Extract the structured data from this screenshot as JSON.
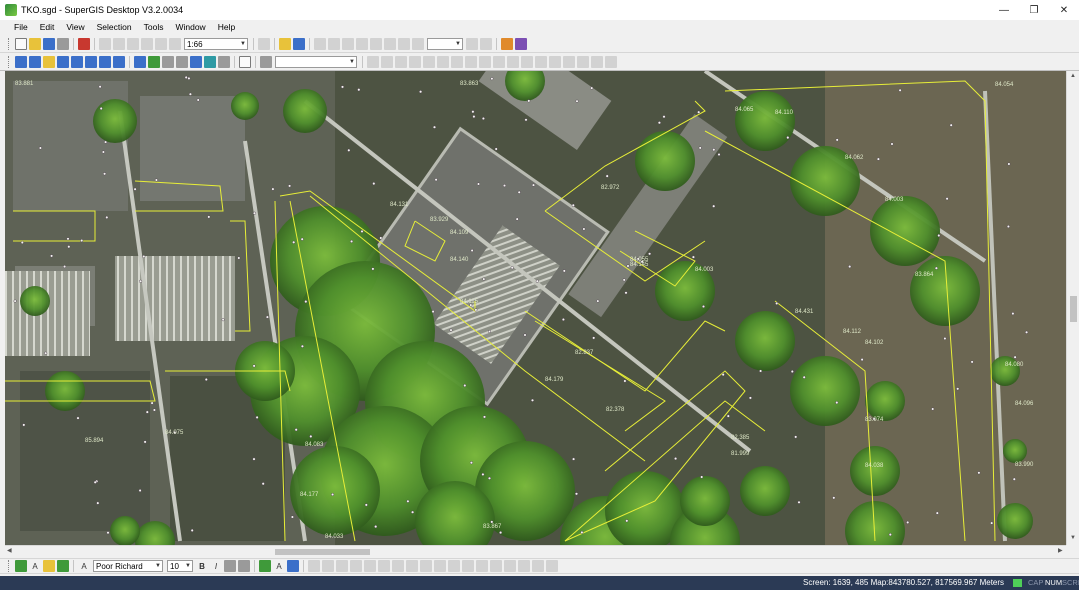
{
  "window": {
    "title": "TKO.sgd - SuperGIS Desktop V3.2.0034",
    "controls": [
      "—",
      "❐",
      "✕"
    ]
  },
  "menu": [
    "File",
    "Edit",
    "View",
    "Selection",
    "Tools",
    "Window",
    "Help"
  ],
  "toolbar1": {
    "scale": "1:66"
  },
  "toolbar3": {
    "font_name": "Poor Richard",
    "font_size": "10",
    "bold": "B",
    "italic": "I"
  },
  "status": {
    "text": "Screen: 1639, 485  Map:843780.527, 817569.967 Meters",
    "indicators": [
      "CAP",
      "NUM",
      "SCRL"
    ]
  },
  "map": {
    "elevation_labels": [
      "83.881",
      "83.863",
      "84.131",
      "83.929",
      "84.109",
      "84.140",
      "84.115",
      "82.972",
      "82.837",
      "84.003",
      "83.864",
      "84.112",
      "84.102",
      "84.431",
      "83.974",
      "84.096",
      "85.894",
      "84.075",
      "84.083",
      "84.177",
      "84.033",
      "83.867",
      "82.385",
      "81.999",
      "82.378",
      "84.038",
      "84.055",
      "84.145",
      "84.179",
      "84.065",
      "84.110",
      "84.062",
      "84.003",
      "84.054",
      "84.080",
      "83.990"
    ]
  },
  "colors": {
    "accent": "#2b3a55",
    "polyline": "#e7ee38",
    "vegetation": "#4f8f2c"
  }
}
